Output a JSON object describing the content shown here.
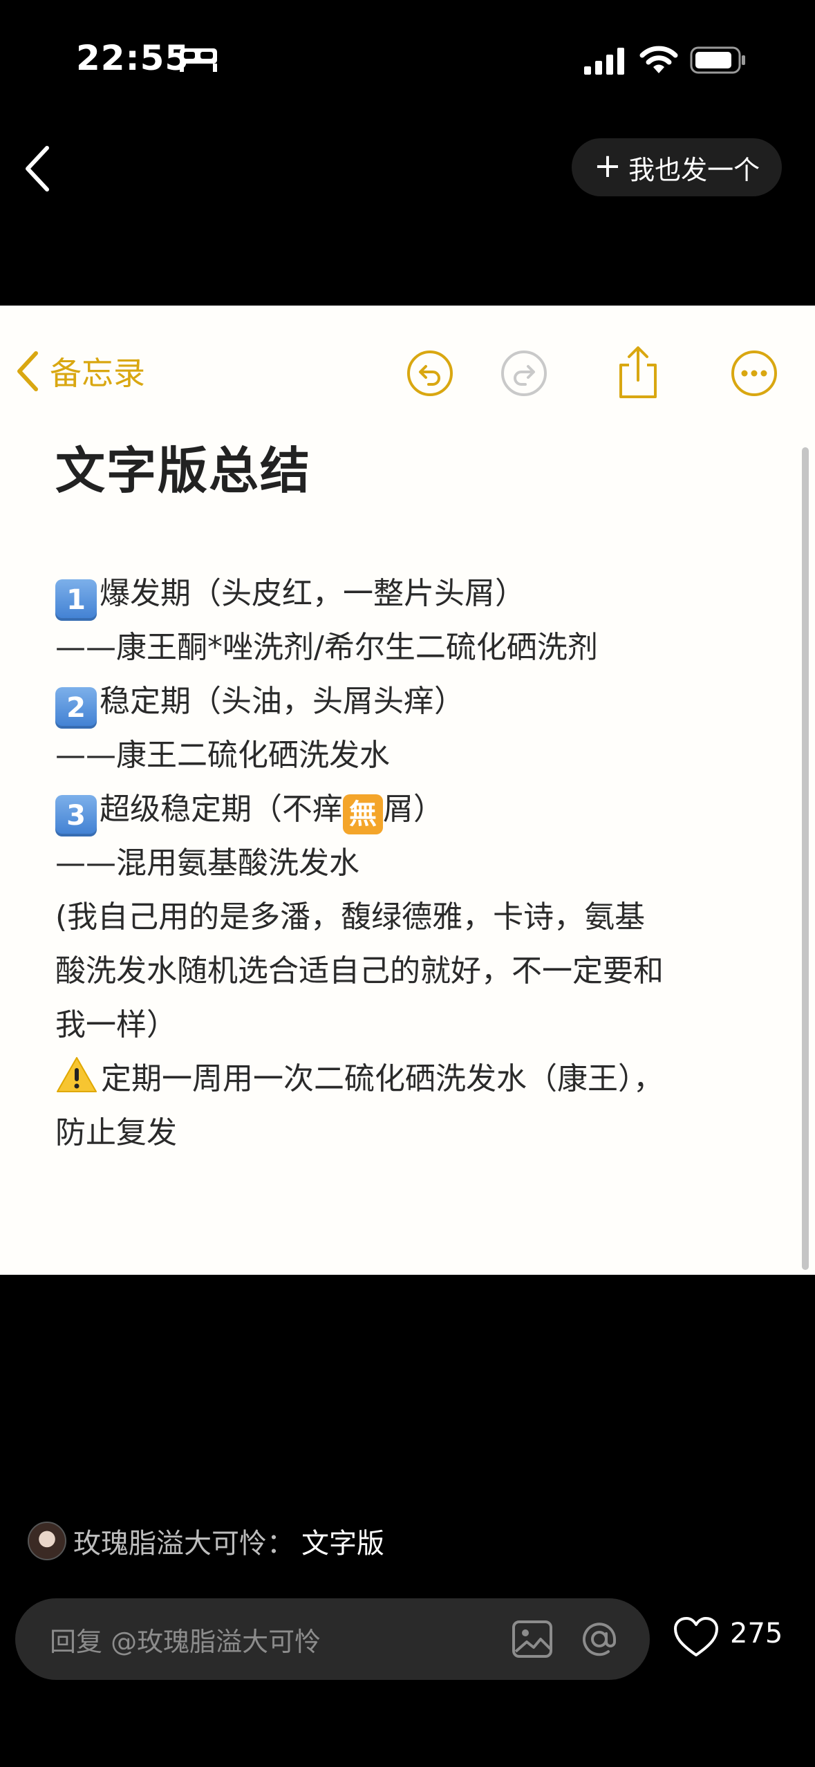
{
  "status_bar": {
    "time": "22:55"
  },
  "nav": {
    "post_button_label": "我也发一个"
  },
  "note_app": {
    "back_label": "备忘录",
    "accent_color": "#d9a711"
  },
  "note": {
    "title": "文字版总结",
    "lines": {
      "l1": "爆发期（头皮红，一整片头屑）",
      "l2": "——康王酮*唑洗剂/希尔生二硫化硒洗剂",
      "l3": "稳定期（头油，头屑头痒）",
      "l4": "——康王二硫化硒洗发水",
      "l5a": "超级稳定期（不痒",
      "l5w": "無",
      "l5b": "屑）",
      "l6": "——混用氨基酸洗发水",
      "l7": "(我自己用的是多潘，馥绿德雅，卡诗，氨基",
      "l8": "酸洗发水随机选合适自己的就好，不一定要和",
      "l9": "我一样）",
      "l10": "定期一周用一次二硫化硒洗发水（康王），",
      "l11": "防止复发"
    },
    "keycaps": [
      "1",
      "2",
      "3"
    ]
  },
  "caption": {
    "author": "玫瑰脂溢大可怜：",
    "text": "文字版"
  },
  "reply": {
    "placeholder": "回复 @玫瑰脂溢大可怜"
  },
  "likes": {
    "count": "275"
  }
}
